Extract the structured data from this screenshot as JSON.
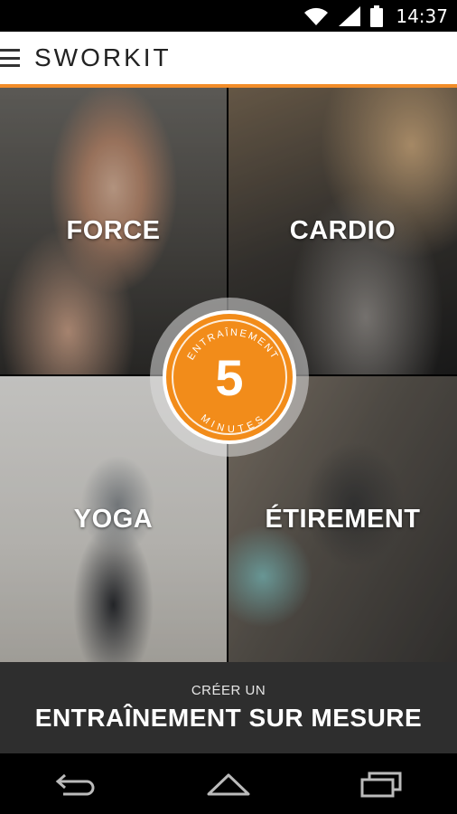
{
  "status_bar": {
    "time": "14:37",
    "icons": [
      "wifi-icon",
      "signal-icon",
      "battery-icon"
    ]
  },
  "app_bar": {
    "brand": "SWORKIT",
    "accent_color": "#f28c28"
  },
  "categories": [
    {
      "label": "FORCE"
    },
    {
      "label": "CARDIO"
    },
    {
      "label": "YOGA"
    },
    {
      "label": "ÉTIREMENT"
    }
  ],
  "badge": {
    "top_text": "ENTRAÎNEMENT",
    "number": "5",
    "bottom_text": "MINUTES",
    "color": "#f28c1a"
  },
  "custom_workout": {
    "small_label": "CRÉER UN",
    "big_label": "ENTRAÎNEMENT SUR MESURE"
  },
  "nav_bar": {
    "icons": [
      "back-icon",
      "home-icon",
      "recents-icon"
    ]
  }
}
